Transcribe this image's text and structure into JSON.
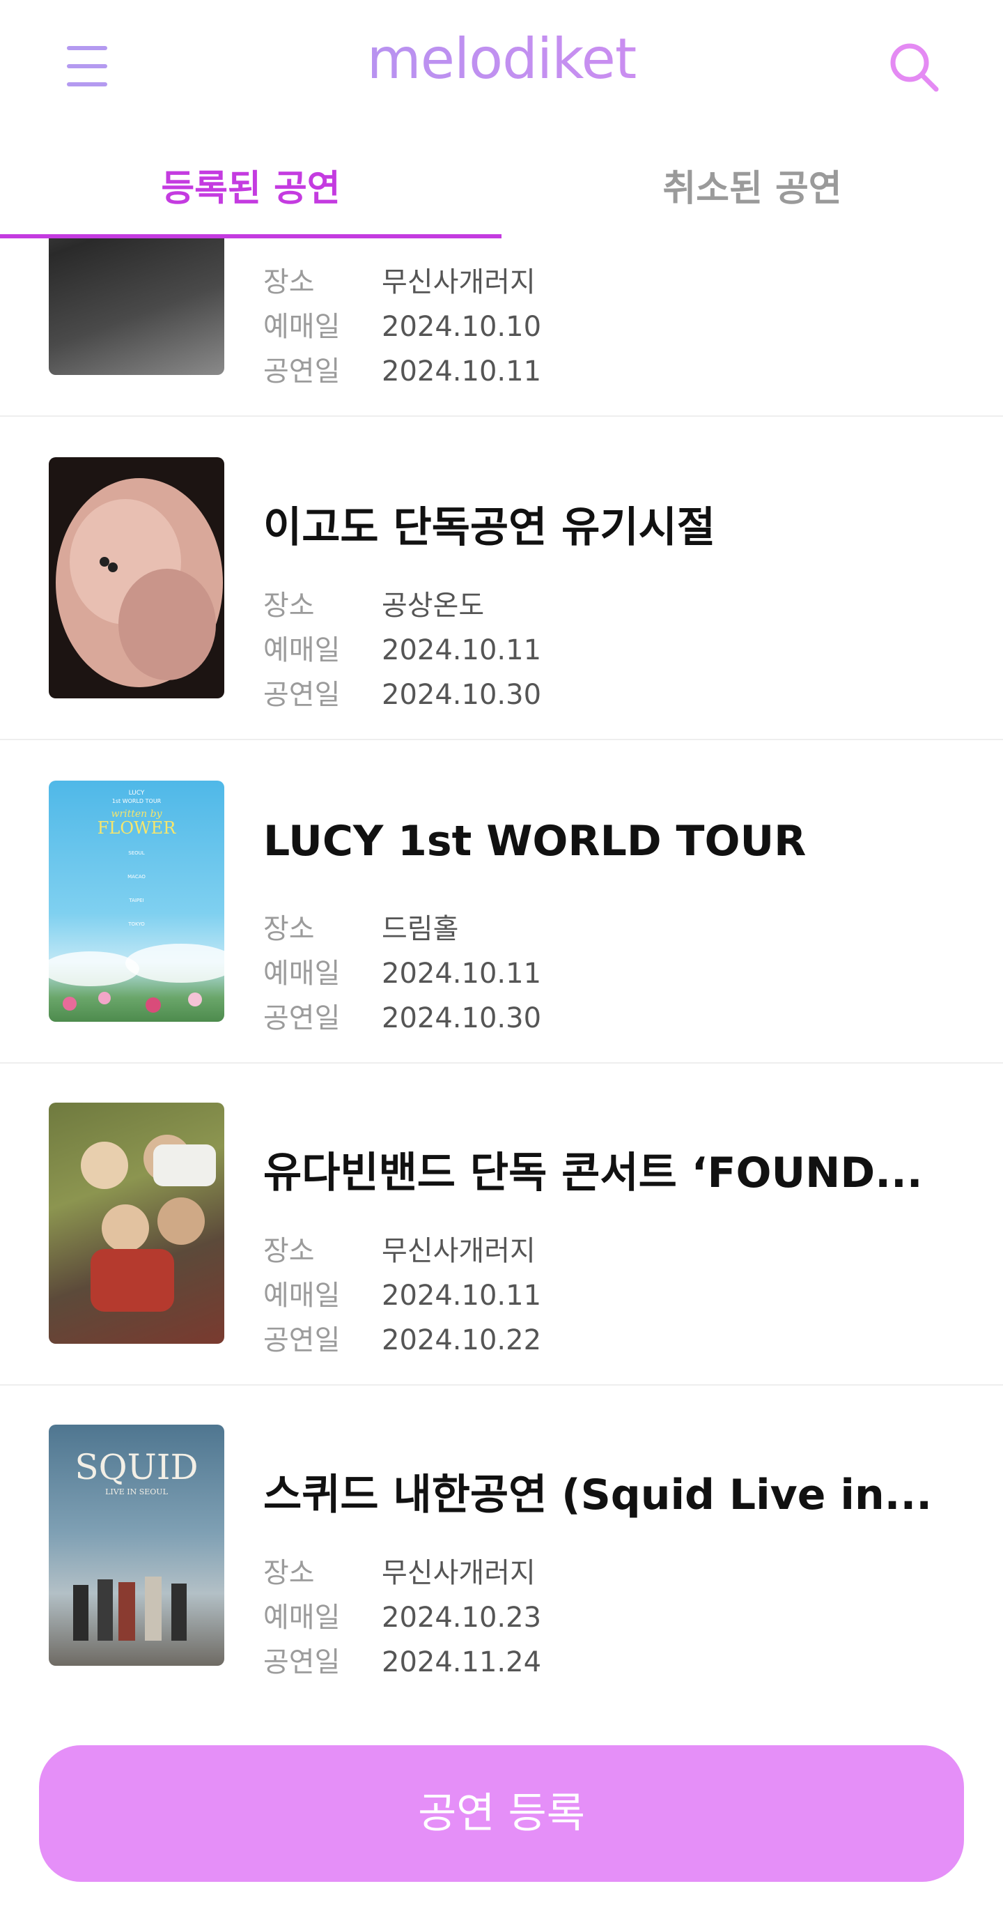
{
  "header": {
    "app_title": "melodiket",
    "menu_icon": "menu-icon",
    "search_icon": "search-icon",
    "accent": "#c43be0"
  },
  "tabs": {
    "registered": "등록된 공연",
    "cancelled": "취소된 공연"
  },
  "labels": {
    "venue": "장소",
    "sale_date": "예매일",
    "show_date": "공연일"
  },
  "concerts": [
    {
      "title": "",
      "venue": "무신사개러지",
      "sale_date": "2024.10.10",
      "show_date": "2024.10.11"
    },
    {
      "title": "이고도 단독공연 유기시절",
      "venue": "공상온도",
      "sale_date": "2024.10.11",
      "show_date": "2024.10.30"
    },
    {
      "title": "LUCY 1st WORLD TOUR",
      "venue": "드림홀",
      "sale_date": "2024.10.11",
      "show_date": "2024.10.30",
      "poster_text": [
        "LUCY",
        "1st WORLD TOUR",
        "written by",
        "FLOWER",
        "SEOUL",
        "MACAO",
        "TAIPEI",
        "TOKYO"
      ]
    },
    {
      "title": "유다빈밴드 단독 콘서트 ‘FOUND...",
      "venue": "무신사개러지",
      "sale_date": "2024.10.11",
      "show_date": "2024.10.22"
    },
    {
      "title": "스퀴드 내한공연 (Squid Live in...",
      "venue": "무신사개러지",
      "sale_date": "2024.10.23",
      "show_date": "2024.11.24",
      "poster_text": [
        "SQUID",
        "LIVE IN SEOUL"
      ]
    }
  ],
  "register_button": "공연 등록"
}
